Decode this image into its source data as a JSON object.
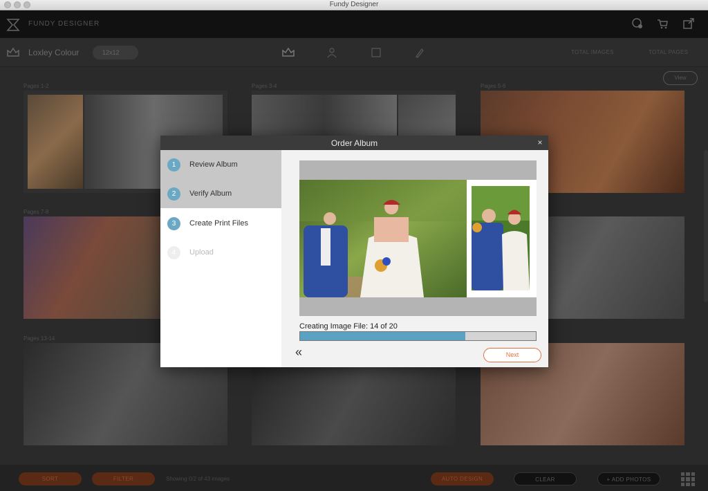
{
  "window": {
    "title": "Fundy Designer"
  },
  "app": {
    "brand": "FUNDY DESIGNER"
  },
  "album": {
    "name": "Loxley Colour",
    "size": "12x12"
  },
  "stats": {
    "stat1": "TOTAL IMAGES",
    "stat2": "TOTAL PAGES"
  },
  "grid": {
    "view_label": "View",
    "spreads": [
      {
        "label": "Pages 1-2"
      },
      {
        "label": "Pages 3-4"
      },
      {
        "label": "Pages 5-6"
      },
      {
        "label": "Pages 7-8"
      },
      {
        "label": ""
      },
      {
        "label": ""
      },
      {
        "label": "Pages 13-14"
      },
      {
        "label": ""
      },
      {
        "label": ""
      }
    ]
  },
  "bottom": {
    "sort": "SORT",
    "filter": "FILTER",
    "showing": "Showing 0/2 of 43 images",
    "auto_design": "AUTO DESIGN",
    "clear": "CLEAR",
    "add_photos": "+ ADD PHOTOS"
  },
  "modal": {
    "title": "Order Album",
    "close": "×",
    "steps": [
      {
        "num": "1",
        "label": "Review Album",
        "state": "done"
      },
      {
        "num": "2",
        "label": "Verify Album",
        "state": "done"
      },
      {
        "num": "3",
        "label": "Create Print Files",
        "state": "active"
      },
      {
        "num": "4",
        "label": "Upload",
        "state": "pending"
      }
    ],
    "progress_text": "Creating Image File: 14 of 20",
    "progress_current": 14,
    "progress_total": 20,
    "back_icon": "«",
    "next_label": "Next"
  },
  "colors": {
    "accent": "#5aa1c2",
    "next": "#e07040"
  },
  "icons": [
    "logo-icon",
    "help-icon",
    "cart-icon",
    "export-icon",
    "album-icon",
    "chevron-double-left-icon",
    "close-icon",
    "grid-view-icon"
  ]
}
